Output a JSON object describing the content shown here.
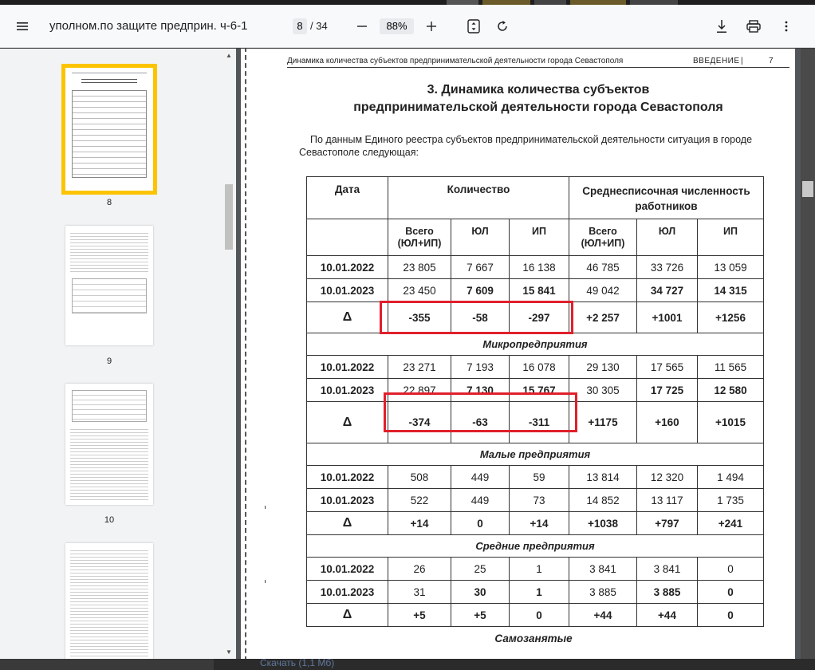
{
  "toolbar": {
    "title": "уполном.по защите предприн. ч-6-1",
    "current_page": "8",
    "total_pages": "/ 34",
    "zoom": "88%"
  },
  "sidebar": {
    "thumbnails": [
      {
        "page": "8",
        "selected": true
      },
      {
        "page": "9",
        "selected": false
      },
      {
        "page": "10",
        "selected": false
      }
    ]
  },
  "document": {
    "running_head": "Динамика количества субъектов предпринимательской деятельности города Севастополя",
    "section": "ВВЕДЕНИЕ",
    "bar": "|",
    "page_num": "7",
    "heading_line1": "3. Динамика количества субъектов",
    "heading_line2": "предпринимательской деятельности города Севастополя",
    "intro": "По данным Единого реестра субъектов предпринимательской деятельности ситуация в городе Севастополе следующая:",
    "table": {
      "col_date": "Дата",
      "col_count": "Количество",
      "col_staff": "Среднесписочная численность работников",
      "sub_total": "Всего (ЮЛ+ИП)",
      "sub_ul": "ЮЛ",
      "sub_ip": "ИП",
      "rows_all": [
        {
          "date": "10.01.2022",
          "v": [
            "23 805",
            "7 667",
            "16 138",
            "46 785",
            "33 726",
            "13 059"
          ]
        },
        {
          "date": "10.01.2023",
          "v": [
            "23 450",
            "7 609",
            "15 841",
            "49 042",
            "34 727",
            "14 315"
          ]
        },
        {
          "date": "Δ",
          "v": [
            "-355",
            "-58",
            "-297",
            "+2 257",
            "+1001",
            "+1256"
          ]
        }
      ],
      "section_micro": "Микропредприятия",
      "rows_micro": [
        {
          "date": "10.01.2022",
          "v": [
            "23 271",
            "7 193",
            "16 078",
            "29 130",
            "17 565",
            "11 565"
          ]
        },
        {
          "date": "10.01.2023",
          "v": [
            "22 897",
            "7 130",
            "15 767",
            "30 305",
            "17 725",
            "12 580"
          ]
        },
        {
          "date": "Δ",
          "v": [
            "-374",
            "-63",
            "-311",
            "+1175",
            "+160",
            "+1015"
          ]
        }
      ],
      "section_small": "Малые предприятия",
      "rows_small": [
        {
          "date": "10.01.2022",
          "v": [
            "508",
            "449",
            "59",
            "13 814",
            "12 320",
            "1 494"
          ]
        },
        {
          "date": "10.01.2023",
          "v": [
            "522",
            "449",
            "73",
            "14 852",
            "13 117",
            "1 735"
          ]
        },
        {
          "date": "Δ",
          "v": [
            "+14",
            "0",
            "+14",
            "+1038",
            "+797",
            "+241"
          ]
        }
      ],
      "section_medium": "Средние предприятия",
      "rows_medium": [
        {
          "date": "10.01.2022",
          "v": [
            "26",
            "25",
            "1",
            "3 841",
            "3 841",
            "0"
          ]
        },
        {
          "date": "10.01.2023",
          "v": [
            "31",
            "30",
            "1",
            "3 885",
            "3 885",
            "0"
          ]
        },
        {
          "date": "Δ",
          "v": [
            "+5",
            "+5",
            "0",
            "+44",
            "+44",
            "0"
          ]
        }
      ]
    },
    "next_heading": "Самозанятые"
  },
  "bottom": {
    "download_link": "Скачать (1,1 Мб)"
  },
  "colors": {
    "highlight": "#e0202c",
    "selected_thumb": "#fcc400",
    "viewer_bg": "#525659"
  }
}
